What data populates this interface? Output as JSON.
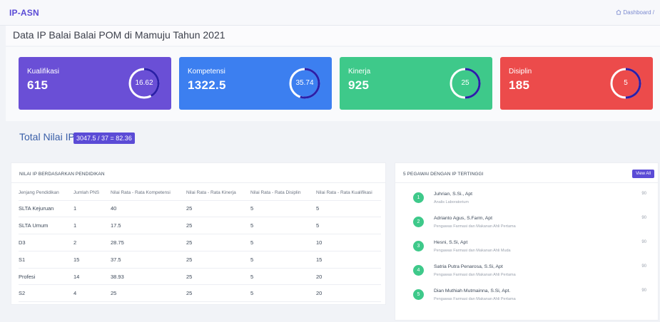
{
  "header": {
    "brand": "IP-ASN",
    "breadcrumb": "Dashboard /"
  },
  "page_title": "Data IP Balai Balai POM di Mamuju Tahun 2021",
  "cards": [
    {
      "label": "Kualifikasi",
      "value": "615",
      "ring": "16.62",
      "color": "#6a4fd6",
      "progress": 0.42
    },
    {
      "label": "Kompetensi",
      "value": "1322.5",
      "ring": "35.74",
      "color": "#3c7ff0",
      "progress": 0.55
    },
    {
      "label": "Kinerja",
      "value": "925",
      "ring": "25",
      "color": "#3ec98a",
      "progress": 0.5
    },
    {
      "label": "Disiplin",
      "value": "185",
      "ring": "5",
      "color": "#ec4b4b",
      "progress": 0.5
    }
  ],
  "total": {
    "label": "Total Nilai IP :",
    "value": "3047.5 / 37 = 82.36"
  },
  "education_table": {
    "title": "NILAI IP BERDASARKAN PENDIDIKAN",
    "columns": [
      "Jenjang Pendidikan",
      "Jumlah PNS",
      "Nilai Rata - Rata Kompetensi",
      "Nilai Rata - Rata Kinerja",
      "Nilai Rata - Rata Disiplin",
      "Nilai Rata - Rata Kualifikasi"
    ],
    "rows": [
      [
        "SLTA Kejuruan",
        "1",
        "40",
        "25",
        "5",
        "5"
      ],
      [
        "SLTA Umum",
        "1",
        "17.5",
        "25",
        "5",
        "5"
      ],
      [
        "D3",
        "2",
        "28.75",
        "25",
        "5",
        "10"
      ],
      [
        "S1",
        "15",
        "37.5",
        "25",
        "5",
        "15"
      ],
      [
        "Profesi",
        "14",
        "38.93",
        "25",
        "5",
        "20"
      ],
      [
        "S2",
        "4",
        "25",
        "25",
        "5",
        "20"
      ]
    ]
  },
  "top_employees": {
    "title": "5 PEGAWAI DENGAN IP TERTINGGI",
    "view_all": "View All",
    "items": [
      {
        "rank": "1",
        "name": "Juhrian, S.Si., Apt",
        "role": "Analis Laboratorium",
        "score": "90"
      },
      {
        "rank": "2",
        "name": "Adrianto Agus, S.Farm, Apt",
        "role": "Pengawas Farmasi dan Makanan Ahli Pertama",
        "score": "90"
      },
      {
        "rank": "3",
        "name": "Hesni, S.Si, Apt",
        "role": "Pengawas Farmasi dan Makanan Ahli Muda",
        "score": "90"
      },
      {
        "rank": "4",
        "name": "Satria Putra Penarosa, S.Si, Apt",
        "role": "Pengawas Farmasi dan Makanan Ahli Pertama",
        "score": "90"
      },
      {
        "rank": "5",
        "name": "Dian Muthiah Mutmainna, S.Si, Apt.",
        "role": "Pengawas Farmasi dan Makanan Ahli Pertama",
        "score": "90"
      }
    ]
  }
}
